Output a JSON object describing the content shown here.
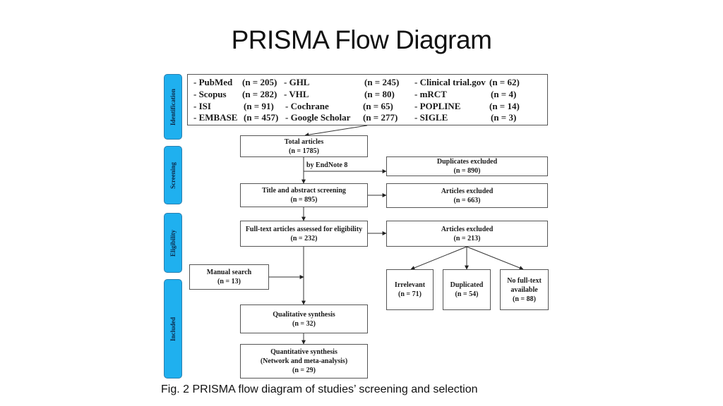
{
  "slide": {
    "title": "PRISMA Flow Diagram",
    "caption": "Fig. 2 PRISMA flow diagram of studies’ screening and selection"
  },
  "stages": [
    {
      "label": "Identification"
    },
    {
      "label": "Screening"
    },
    {
      "label": "Eligibility"
    },
    {
      "label": "Included"
    }
  ],
  "stage_color": "#1fb0ef",
  "identification": {
    "sources": [
      {
        "name": "- PubMed",
        "count": "(n = 205)"
      },
      {
        "name": "- Scopus",
        "count": "(n = 282)"
      },
      {
        "name": "- ISI",
        "count": "(n = 91)"
      },
      {
        "name": "- EMBASE",
        "count": "(n = 457)"
      },
      {
        "name": "- GHL",
        "count": "(n = 245)"
      },
      {
        "name": "- VHL",
        "count": "(n = 80)"
      },
      {
        "name": "- Cochrane",
        "count": "(n = 65)"
      },
      {
        "name": "- Google Scholar",
        "count": "(n = 277)"
      },
      {
        "name": "- Clinical trial.gov",
        "count": "(n = 62)"
      },
      {
        "name": "- mRCT",
        "count": "(n = 4)"
      },
      {
        "name": "- POPLINE",
        "count": "(n = 14)"
      },
      {
        "name": "- SIGLE",
        "count": "(n = 3)"
      }
    ]
  },
  "boxes": {
    "total": {
      "label": "Total articles",
      "count": "(n = 1785)"
    },
    "endnote_note": "by EndNote 8",
    "duplicates": {
      "label": "Duplicates excluded",
      "count": "(n = 890)"
    },
    "title_abstract": {
      "label": "Title and abstract screening",
      "count": "(n = 895)"
    },
    "excluded_screening": {
      "label": "Articles excluded",
      "count": "(n = 663)"
    },
    "fulltext": {
      "label": "Full-text articles assessed for eligibility",
      "count": "(n = 232)"
    },
    "excluded_eligibility": {
      "label": "Articles excluded",
      "count": "(n = 213)"
    },
    "irrelevant": {
      "label": "Irrelevant",
      "count": "(n = 71)"
    },
    "duplicated": {
      "label": "Duplicated",
      "count": "(n = 54)"
    },
    "no_fulltext": {
      "label1": "No full-text",
      "label2": "available",
      "count": "(n = 88)"
    },
    "manual": {
      "label": "Manual search",
      "count": "(n = 13)"
    },
    "qualitative": {
      "label": "Qualitative synthesis",
      "count": "(n = 32)"
    },
    "quantitative": {
      "label": "Quantitative synthesis",
      "sub": "(Network and meta-analysis)",
      "count": "(n = 29)"
    }
  }
}
